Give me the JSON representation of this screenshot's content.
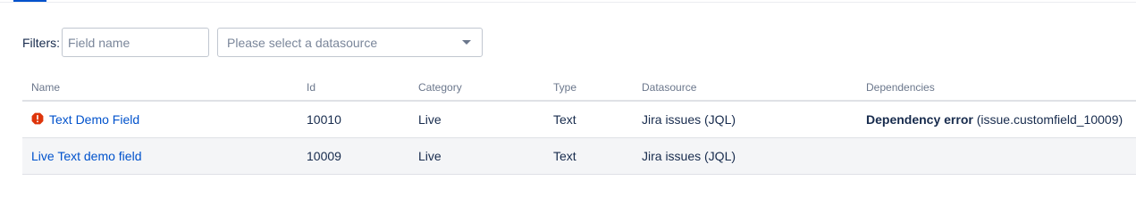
{
  "filters": {
    "label": "Filters:",
    "field_name_placeholder": "Field name",
    "datasource_placeholder": "Please select a datasource"
  },
  "table": {
    "headers": {
      "name": "Name",
      "id": "Id",
      "category": "Category",
      "type": "Type",
      "datasource": "Datasource",
      "dependencies": "Dependencies"
    },
    "rows": [
      {
        "name": "Text Demo Field",
        "id": "10010",
        "category": "Live",
        "type": "Text",
        "datasource": "Jira issues (JQL)",
        "dependency_error": "Dependency error",
        "dependency_detail": "(issue.customfield_10009)",
        "has_error_icon": true
      },
      {
        "name": "Live Text demo field",
        "id": "10009",
        "category": "Live",
        "type": "Text",
        "datasource": "Jira issues (JQL)",
        "dependency_error": "",
        "dependency_detail": "",
        "has_error_icon": false
      }
    ]
  },
  "colors": {
    "link": "#0052cc",
    "error_icon": "#de350b",
    "header_text": "#6b778c",
    "alt_row_bg": "#f4f5f7"
  },
  "icons": {
    "error": "error-icon",
    "dropdown": "chevron-down-icon"
  }
}
